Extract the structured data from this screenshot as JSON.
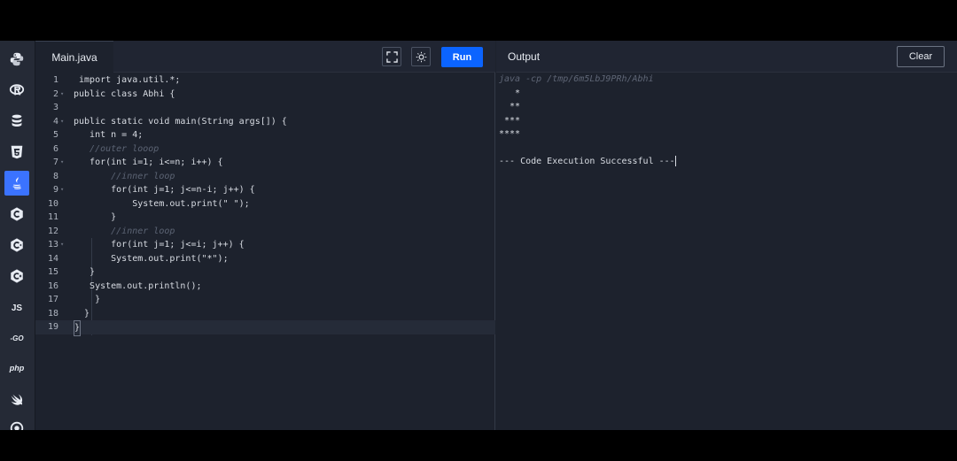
{
  "sidebar": {
    "items": [
      {
        "name": "python",
        "icon": "python-icon"
      },
      {
        "name": "r",
        "icon": "r-icon"
      },
      {
        "name": "sql",
        "icon": "database-icon"
      },
      {
        "name": "html",
        "icon": "html5-icon"
      },
      {
        "name": "java",
        "icon": "java-icon",
        "active": true
      },
      {
        "name": "c",
        "icon": "c-icon"
      },
      {
        "name": "cpp",
        "icon": "cpp-icon"
      },
      {
        "name": "csharp",
        "icon": "csharp-icon"
      },
      {
        "name": "js",
        "label": "JS"
      },
      {
        "name": "go",
        "label": "-GO"
      },
      {
        "name": "php",
        "label": "php"
      },
      {
        "name": "swift",
        "icon": "swift-icon"
      },
      {
        "name": "rust",
        "icon": "rust-icon"
      }
    ]
  },
  "editor": {
    "file_tab": "Main.java",
    "run_label": "Run",
    "lines": [
      {
        "n": "1",
        "text": " import java.util.*;"
      },
      {
        "n": "2",
        "text": "public class Abhi {"
      },
      {
        "n": "3",
        "text": ""
      },
      {
        "n": "4",
        "text": "public static void main(String args[]) {"
      },
      {
        "n": "5",
        "text": "   int n = 4;"
      },
      {
        "n": "6",
        "text": "   //outer looop"
      },
      {
        "n": "7",
        "text": "   for(int i=1; i<=n; i++) {"
      },
      {
        "n": "8",
        "text": "       //inner loop"
      },
      {
        "n": "9",
        "text": "       for(int j=1; j<=n-i; j++) {"
      },
      {
        "n": "10",
        "text": "           System.out.print(\" \");"
      },
      {
        "n": "11",
        "text": "       }"
      },
      {
        "n": "12",
        "text": "       //inner loop"
      },
      {
        "n": "13",
        "text": "       for(int j=1; j<=i; j++) {"
      },
      {
        "n": "14",
        "text": "       System.out.print(\"*\");"
      },
      {
        "n": "15",
        "text": "   }"
      },
      {
        "n": "16",
        "text": "   System.out.println();"
      },
      {
        "n": "17",
        "text": "    }"
      },
      {
        "n": "18",
        "text": "  }"
      },
      {
        "n": "19",
        "text": "}"
      }
    ]
  },
  "output": {
    "title": "Output",
    "clear_label": "Clear",
    "command": "java -cp /tmp/6m5LbJ9PRh/Abhi",
    "lines": [
      "   *",
      "  **",
      " ***",
      "****",
      "",
      "--- Code Execution Successful ---"
    ]
  },
  "colors": {
    "accent": "#0b64ff",
    "background": "#1d222d"
  }
}
